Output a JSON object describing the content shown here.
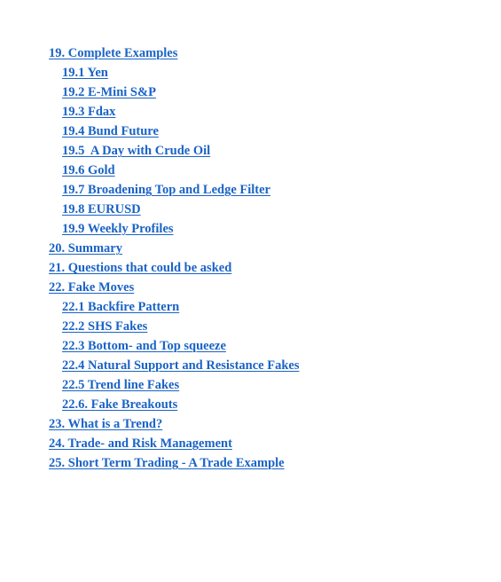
{
  "toc": {
    "link_color": "#1a63c6",
    "items": [
      {
        "label": "19. Complete Examples",
        "level": 1
      },
      {
        "label": "19.1 Yen",
        "level": 2
      },
      {
        "label": "19.2 E-Mini S&P",
        "level": 2
      },
      {
        "label": "19.3 Fdax",
        "level": 2
      },
      {
        "label": "19.4 Bund Future",
        "level": 2
      },
      {
        "label": "19.5  A Day with Crude Oil",
        "level": 2
      },
      {
        "label": "19.6 Gold",
        "level": 2
      },
      {
        "label": "19.7 Broadening Top and Ledge Filter",
        "level": 2
      },
      {
        "label": "19.8 EURUSD",
        "level": 2
      },
      {
        "label": "19.9 Weekly Profiles",
        "level": 2
      },
      {
        "label": "20. Summary",
        "level": 1
      },
      {
        "label": "21. Questions that could be asked",
        "level": 1
      },
      {
        "label": "22. Fake Moves",
        "level": 1
      },
      {
        "label": "22.1 Backfire Pattern",
        "level": 2
      },
      {
        "label": "22.2 SHS Fakes",
        "level": 2
      },
      {
        "label": "22.3 Bottom- and Top squeeze",
        "level": 2
      },
      {
        "label": "22.4 Natural Support and Resistance Fakes",
        "level": 2
      },
      {
        "label": "22.5 Trend line Fakes",
        "level": 2
      },
      {
        "label": "22.6. Fake Breakouts",
        "level": 2
      },
      {
        "label": "23. What is a Trend?",
        "level": 1
      },
      {
        "label": "24. Trade- and Risk Management",
        "level": 1
      },
      {
        "label": "25. Short Term Trading - A Trade Example",
        "level": 1
      }
    ]
  }
}
